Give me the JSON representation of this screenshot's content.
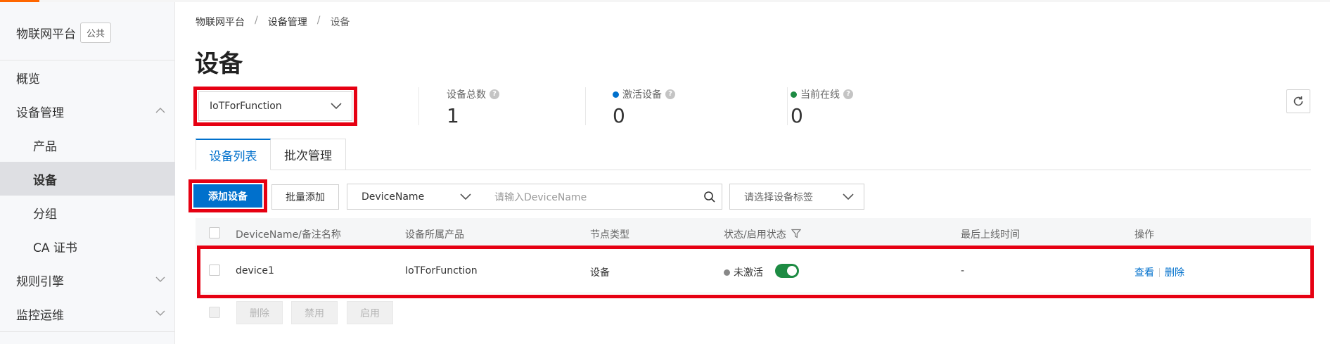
{
  "sidebar": {
    "brand_title": "物联网平台",
    "brand_badge": "公共",
    "items": [
      {
        "label": "概览"
      },
      {
        "label": "设备管理"
      },
      {
        "label": "产品"
      },
      {
        "label": "设备"
      },
      {
        "label": "分组"
      },
      {
        "label": "CA 证书"
      },
      {
        "label": "规则引擎"
      },
      {
        "label": "监控运维"
      }
    ]
  },
  "breadcrumb": [
    "物联网平台",
    "/",
    "设备管理",
    "/",
    "设备"
  ],
  "page_title": "设备",
  "product_select": {
    "value": "IoTForFunction"
  },
  "stats": [
    {
      "label": "设备总数",
      "value": "1",
      "dot_color": ""
    },
    {
      "label": "激活设备",
      "value": "0",
      "dot_color": "#0070cc"
    },
    {
      "label": "当前在线",
      "value": "0",
      "dot_color": "#1d8b43"
    }
  ],
  "tabs": [
    {
      "label": "设备列表",
      "active": true
    },
    {
      "label": "批次管理",
      "active": false
    }
  ],
  "toolbar": {
    "add_device": "添加设备",
    "batch_add": "批量添加",
    "field_select": "DeviceName",
    "search_placeholder": "请输入DeviceName",
    "tag_select_placeholder": "请选择设备标签"
  },
  "table": {
    "columns": [
      "DeviceName/备注名称",
      "设备所属产品",
      "节点类型",
      "状态/启用状态",
      "最后上线时间",
      "操作"
    ],
    "rows": [
      {
        "device_name": "device1",
        "product": "IoTForFunction",
        "node_type": "设备",
        "status": "未激活",
        "enabled": true,
        "last_online": "-",
        "actions": [
          "查看",
          "删除"
        ]
      }
    ]
  },
  "bulk_actions": [
    "删除",
    "禁用",
    "启用"
  ],
  "colors": {
    "accent_blue": "#0070cc",
    "highlight_red": "#e60012",
    "toggle_green": "#1d8b43",
    "brand_orange": "#ff6600"
  }
}
